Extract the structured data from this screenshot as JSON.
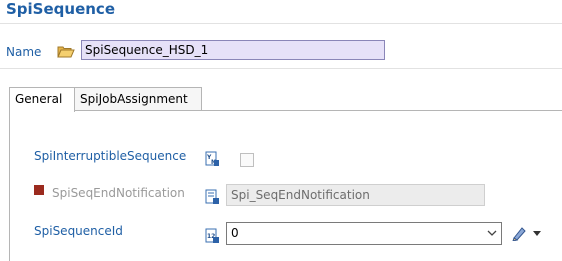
{
  "editor": {
    "title": "SpiSequence"
  },
  "name_row": {
    "label": "Name",
    "icon": "folder-open-icon",
    "value": "SpiSequence_HSD_1"
  },
  "tabs": [
    {
      "label": "General",
      "active": true
    },
    {
      "label": "SpiJobAssignment",
      "active": false
    }
  ],
  "fields": {
    "interruptible": {
      "label": "SpiInterruptibleSequence",
      "icon": "boolean-type-icon",
      "checked": false
    },
    "end_notification": {
      "label": "SpiSeqEndNotification",
      "icon": "reference-type-icon",
      "placeholder": "Spi_SeqEndNotification",
      "enabled": false
    },
    "sequence_id": {
      "label": "SpiSequenceId",
      "icon": "integer-type-icon",
      "value": "0"
    }
  },
  "colors": {
    "label_blue": "#1f5fa5",
    "name_input_bg": "#e6e1f8",
    "disabled_marker": "#9b2a1e"
  }
}
